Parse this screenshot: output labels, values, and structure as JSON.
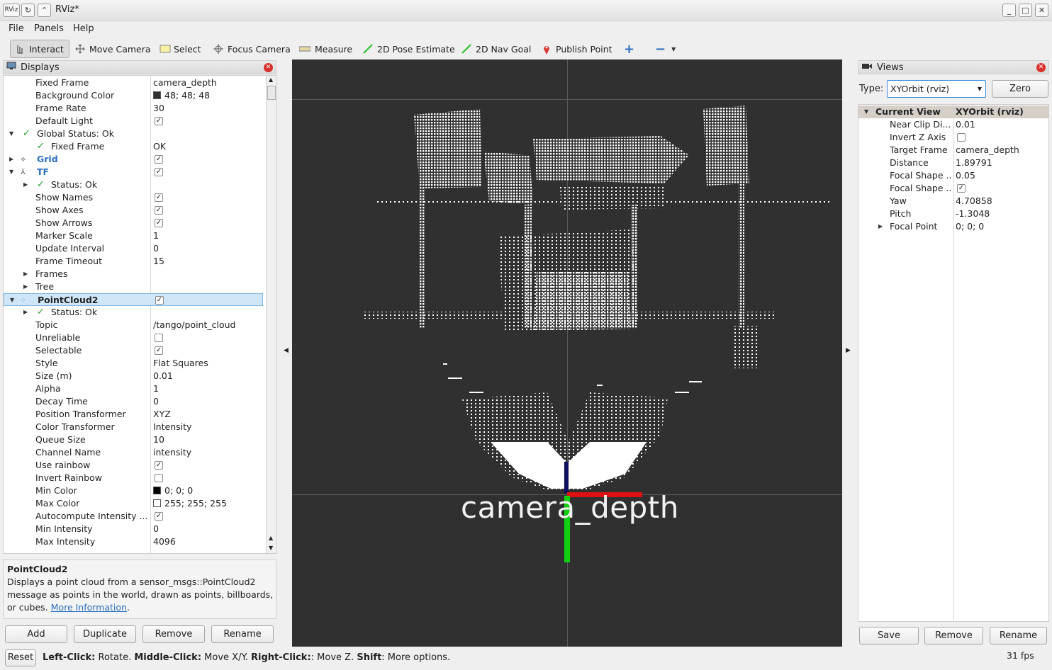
{
  "window": {
    "title": "RViz*",
    "logo_text": "RViz",
    "buttons": [
      "Minimize",
      "Maximize",
      "Close"
    ]
  },
  "menubar": [
    "File",
    "Panels",
    "Help"
  ],
  "toolbar": [
    {
      "label": "Interact",
      "icon": "hand-pointer-icon",
      "active": true
    },
    {
      "label": "Move Camera",
      "icon": "move-arrows-icon"
    },
    {
      "label": "Select",
      "icon": "select-rect-icon"
    },
    {
      "label": "Focus Camera",
      "icon": "crosshair-icon"
    },
    {
      "label": "Measure",
      "icon": "ruler-icon"
    },
    {
      "label": "2D Pose Estimate",
      "icon": "green-arrow-icon"
    },
    {
      "label": "2D Nav Goal",
      "icon": "green-arrow-icon"
    },
    {
      "label": "Publish Point",
      "icon": "map-pin-icon"
    }
  ],
  "displays": {
    "title": "Displays",
    "rows": [
      {
        "label": "Fixed Frame",
        "value": "camera_depth"
      },
      {
        "label": "Background Color",
        "value": "48; 48; 48",
        "swatch": "#303030"
      },
      {
        "label": "Frame Rate",
        "value": "30"
      },
      {
        "label": "Default Light",
        "check": true
      },
      {
        "label": "Global Status: Ok",
        "status": true,
        "expanded": true
      },
      {
        "label": "Fixed Frame",
        "value": "OK",
        "status": true
      },
      {
        "label": "Grid",
        "check": true,
        "blue": true
      },
      {
        "label": "TF",
        "check": true,
        "blue": true,
        "expanded": true
      },
      {
        "label": "Status: Ok",
        "status": true
      },
      {
        "label": "Show Names",
        "check": true
      },
      {
        "label": "Show Axes",
        "check": true
      },
      {
        "label": "Show Arrows",
        "check": true
      },
      {
        "label": "Marker Scale",
        "value": "1"
      },
      {
        "label": "Update Interval",
        "value": "0"
      },
      {
        "label": "Frame Timeout",
        "value": "15"
      },
      {
        "label": "Frames"
      },
      {
        "label": "Tree"
      },
      {
        "label": "PointCloud2",
        "check": true,
        "selected": true,
        "expanded": true
      },
      {
        "label": "Status: Ok",
        "status": true
      },
      {
        "label": "Topic",
        "value": "/tango/point_cloud"
      },
      {
        "label": "Unreliable",
        "check": false
      },
      {
        "label": "Selectable",
        "check": true
      },
      {
        "label": "Style",
        "value": "Flat Squares"
      },
      {
        "label": "Size (m)",
        "value": "0.01"
      },
      {
        "label": "Alpha",
        "value": "1"
      },
      {
        "label": "Decay Time",
        "value": "0"
      },
      {
        "label": "Position Transformer",
        "value": "XYZ"
      },
      {
        "label": "Color Transformer",
        "value": "Intensity"
      },
      {
        "label": "Queue Size",
        "value": "10"
      },
      {
        "label": "Channel Name",
        "value": "intensity"
      },
      {
        "label": "Use rainbow",
        "check": true
      },
      {
        "label": "Invert Rainbow",
        "check": false
      },
      {
        "label": "Min Color",
        "value": "0; 0; 0",
        "swatch": "#000000"
      },
      {
        "label": "Max Color",
        "value": "255; 255; 255",
        "swatch": "#ffffff"
      },
      {
        "label": "Autocompute Intensity ...",
        "check": true
      },
      {
        "label": "Min Intensity",
        "value": "0"
      },
      {
        "label": "Max Intensity",
        "value": "4096"
      }
    ],
    "desc_title": "PointCloud2",
    "desc_text": "Displays a point cloud from a sensor_msgs::PointCloud2 message as points in the world, drawn as points, billboards, or cubes.",
    "desc_link": "More Information",
    "desc_tail": ".",
    "buttons": [
      "Add",
      "Duplicate",
      "Remove",
      "Rename"
    ]
  },
  "viewport": {
    "frame_label": "camera_depth"
  },
  "views": {
    "title": "Views",
    "type_label": "Type:",
    "type_value": "XYOrbit (rviz)",
    "zero_label": "Zero",
    "header": {
      "label": "Current View",
      "value": "XYOrbit (rviz)"
    },
    "rows": [
      {
        "label": "Near Clip Di...",
        "value": "0.01"
      },
      {
        "label": "Invert Z Axis",
        "check": false
      },
      {
        "label": "Target Frame",
        "value": "camera_depth"
      },
      {
        "label": "Distance",
        "value": "1.89791"
      },
      {
        "label": "Focal Shape ...",
        "value": "0.05"
      },
      {
        "label": "Focal Shape ...",
        "check": true
      },
      {
        "label": "Yaw",
        "value": "4.70858"
      },
      {
        "label": "Pitch",
        "value": "-1.3048"
      },
      {
        "label": "Focal Point",
        "value": "0; 0; 0",
        "expandable": true
      }
    ],
    "buttons": [
      "Save",
      "Remove",
      "Rename"
    ]
  },
  "statusbar": {
    "reset_label": "Reset",
    "hint_parts": [
      {
        "bold": true,
        "text": "Left-Click:"
      },
      {
        "text": " Rotate. "
      },
      {
        "bold": true,
        "text": "Middle-Click:"
      },
      {
        "text": " Move X/Y. "
      },
      {
        "bold": true,
        "text": "Right-Click:"
      },
      {
        "text": ": Move Z. "
      },
      {
        "bold": true,
        "text": "Shift"
      },
      {
        "text": ": More options."
      }
    ],
    "fps": "31 fps"
  },
  "colors": {
    "viewport_bg": "#303030",
    "selection": "#cfe6f8",
    "link": "#2a6fbf",
    "status_ok": "#2aa12a",
    "x_axis": "#e01010",
    "y_axis": "#10d010",
    "z_axis": "#101060"
  }
}
